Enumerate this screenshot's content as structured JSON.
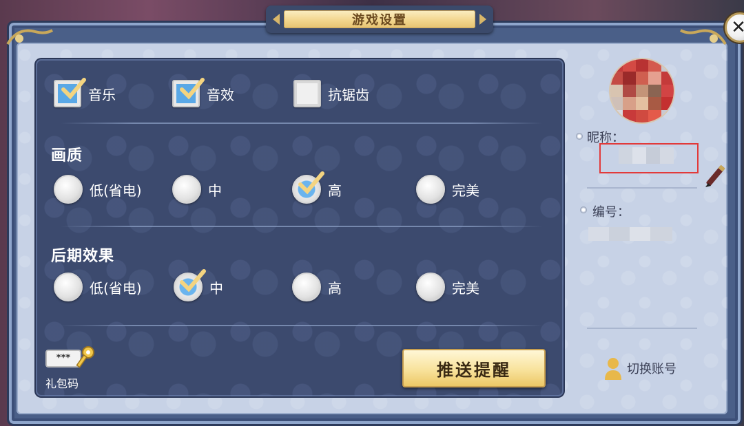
{
  "title": "游戏设置",
  "close_icon": "close-icon",
  "audio": {
    "music": {
      "label": "音乐",
      "checked": true
    },
    "sfx": {
      "label": "音效",
      "checked": true
    },
    "antialias": {
      "label": "抗锯齿",
      "checked": false
    }
  },
  "quality": {
    "title": "画质",
    "options": [
      {
        "label": "低(省电)",
        "checked": false
      },
      {
        "label": "中",
        "checked": false
      },
      {
        "label": "高",
        "checked": true
      },
      {
        "label": "完美",
        "checked": false
      }
    ]
  },
  "postfx": {
    "title": "后期效果",
    "options": [
      {
        "label": "低(省电)",
        "checked": false
      },
      {
        "label": "中",
        "checked": true
      },
      {
        "label": "高",
        "checked": false
      },
      {
        "label": "完美",
        "checked": false
      }
    ]
  },
  "gift": {
    "label": "礼包码",
    "mask": "***"
  },
  "push_button": "推送提醒",
  "profile": {
    "nickname_label": "昵称：",
    "id_label": "编号：",
    "switch_account": "切换账号"
  },
  "colors": {
    "panel": "#3c4a6e",
    "accent_check": "#5aa8e6",
    "gold": "#f2d68e",
    "highlight_box": "#e23a3a"
  }
}
